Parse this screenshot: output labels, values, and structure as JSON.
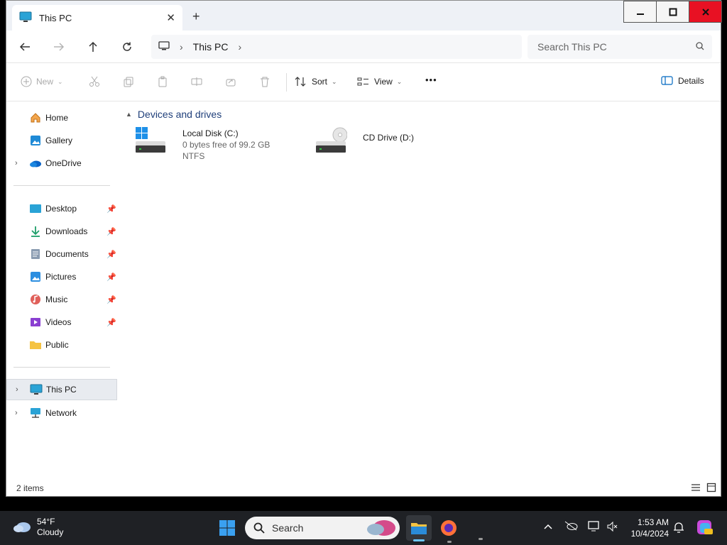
{
  "window": {
    "tab_title": "This PC",
    "close_tab": "✕",
    "new_tab": "+"
  },
  "address": {
    "breadcrumb": [
      "This PC"
    ],
    "search_placeholder": "Search This PC"
  },
  "commands": {
    "new_label": "New",
    "sort_label": "Sort",
    "view_label": "View",
    "more_label": "•••",
    "details_label": "Details"
  },
  "sidebar": {
    "top": [
      {
        "label": "Home",
        "icon": "home-icon"
      },
      {
        "label": "Gallery",
        "icon": "gallery-icon"
      },
      {
        "label": "OneDrive",
        "icon": "onedrive-icon"
      }
    ],
    "quick": [
      {
        "label": "Desktop",
        "icon": "desktop-icon"
      },
      {
        "label": "Downloads",
        "icon": "downloads-icon"
      },
      {
        "label": "Documents",
        "icon": "documents-icon"
      },
      {
        "label": "Pictures",
        "icon": "pictures-icon"
      },
      {
        "label": "Music",
        "icon": "music-icon"
      },
      {
        "label": "Videos",
        "icon": "videos-icon"
      },
      {
        "label": "Public",
        "icon": "folder-icon"
      }
    ],
    "bottom": [
      {
        "label": "This PC",
        "icon": "this-pc-icon"
      },
      {
        "label": "Network",
        "icon": "network-icon"
      }
    ]
  },
  "content": {
    "group_title": "Devices and drives",
    "drives": [
      {
        "name": "Local Disk (C:)",
        "free": "0 bytes free of 99.2 GB",
        "fs": "NTFS"
      },
      {
        "name": "CD Drive (D:)"
      }
    ]
  },
  "status": {
    "item_count": "2 items"
  },
  "taskbar": {
    "temp": "54°F",
    "condition": "Cloudy",
    "search_label": "Search",
    "time": "1:53 AM",
    "date": "10/4/2024"
  },
  "colors": {
    "accent": "#0067c0",
    "group_header": "#1f3f7a",
    "close_button": "#e81123"
  }
}
